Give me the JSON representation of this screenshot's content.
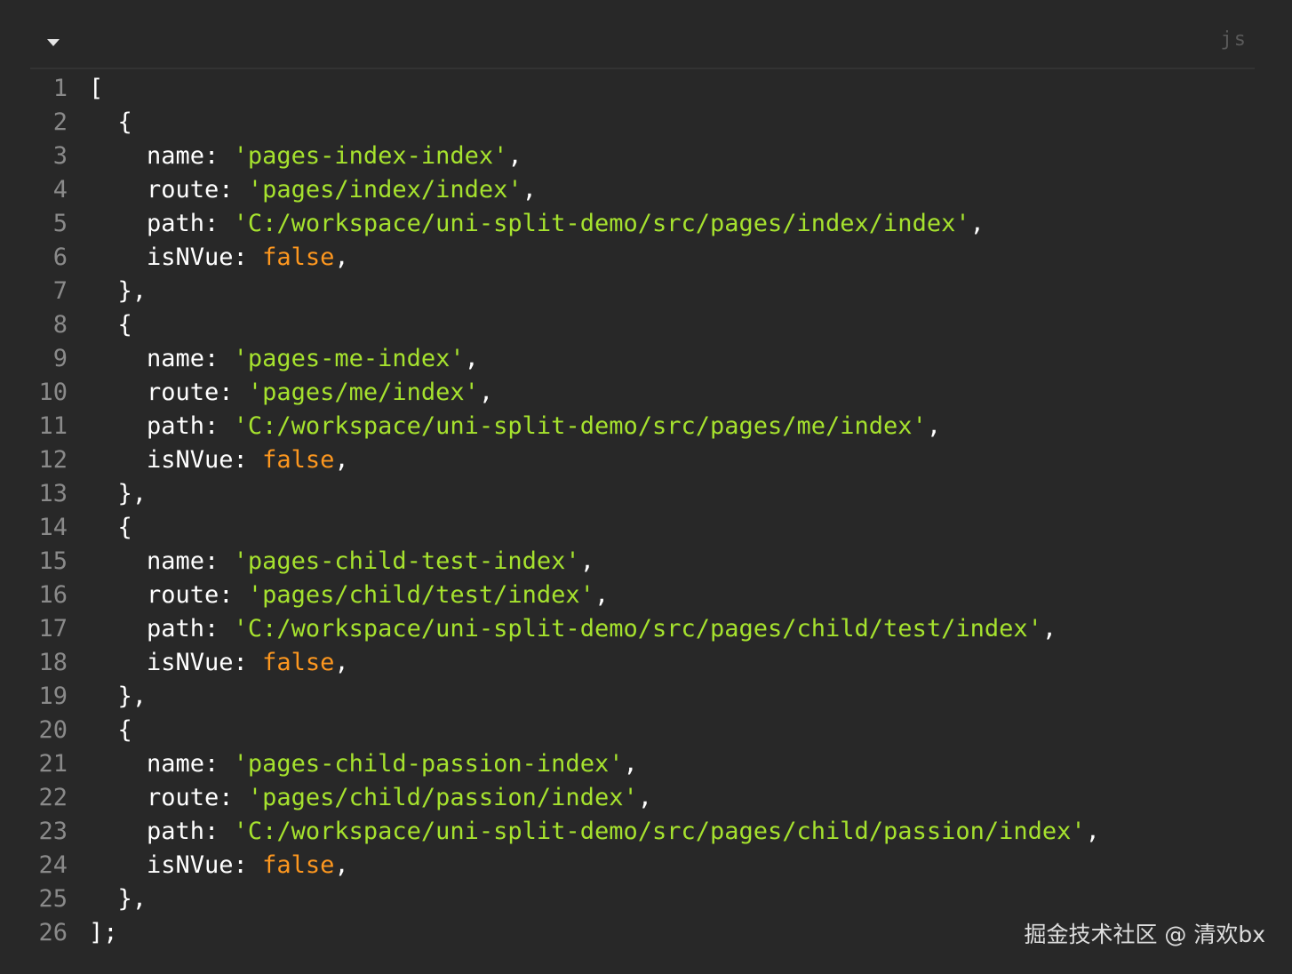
{
  "header": {
    "language": "js",
    "collapse_icon": "caret-down-icon"
  },
  "code": {
    "lines": [
      [
        {
          "t": "p",
          "v": "["
        }
      ],
      [
        {
          "t": "p",
          "v": "  {"
        }
      ],
      [
        {
          "t": "p",
          "v": "    name: "
        },
        {
          "t": "s",
          "v": "'pages-index-index'"
        },
        {
          "t": "p",
          "v": ","
        }
      ],
      [
        {
          "t": "p",
          "v": "    route: "
        },
        {
          "t": "s",
          "v": "'pages/index/index'"
        },
        {
          "t": "p",
          "v": ","
        }
      ],
      [
        {
          "t": "p",
          "v": "    path: "
        },
        {
          "t": "s",
          "v": "'C:/workspace/uni-split-demo/src/pages/index/index'"
        },
        {
          "t": "p",
          "v": ","
        }
      ],
      [
        {
          "t": "p",
          "v": "    isNVue: "
        },
        {
          "t": "b",
          "v": "false"
        },
        {
          "t": "p",
          "v": ","
        }
      ],
      [
        {
          "t": "p",
          "v": "  },"
        }
      ],
      [
        {
          "t": "p",
          "v": "  {"
        }
      ],
      [
        {
          "t": "p",
          "v": "    name: "
        },
        {
          "t": "s",
          "v": "'pages-me-index'"
        },
        {
          "t": "p",
          "v": ","
        }
      ],
      [
        {
          "t": "p",
          "v": "    route: "
        },
        {
          "t": "s",
          "v": "'pages/me/index'"
        },
        {
          "t": "p",
          "v": ","
        }
      ],
      [
        {
          "t": "p",
          "v": "    path: "
        },
        {
          "t": "s",
          "v": "'C:/workspace/uni-split-demo/src/pages/me/index'"
        },
        {
          "t": "p",
          "v": ","
        }
      ],
      [
        {
          "t": "p",
          "v": "    isNVue: "
        },
        {
          "t": "b",
          "v": "false"
        },
        {
          "t": "p",
          "v": ","
        }
      ],
      [
        {
          "t": "p",
          "v": "  },"
        }
      ],
      [
        {
          "t": "p",
          "v": "  {"
        }
      ],
      [
        {
          "t": "p",
          "v": "    name: "
        },
        {
          "t": "s",
          "v": "'pages-child-test-index'"
        },
        {
          "t": "p",
          "v": ","
        }
      ],
      [
        {
          "t": "p",
          "v": "    route: "
        },
        {
          "t": "s",
          "v": "'pages/child/test/index'"
        },
        {
          "t": "p",
          "v": ","
        }
      ],
      [
        {
          "t": "p",
          "v": "    path: "
        },
        {
          "t": "s",
          "v": "'C:/workspace/uni-split-demo/src/pages/child/test/index'"
        },
        {
          "t": "p",
          "v": ","
        }
      ],
      [
        {
          "t": "p",
          "v": "    isNVue: "
        },
        {
          "t": "b",
          "v": "false"
        },
        {
          "t": "p",
          "v": ","
        }
      ],
      [
        {
          "t": "p",
          "v": "  },"
        }
      ],
      [
        {
          "t": "p",
          "v": "  {"
        }
      ],
      [
        {
          "t": "p",
          "v": "    name: "
        },
        {
          "t": "s",
          "v": "'pages-child-passion-index'"
        },
        {
          "t": "p",
          "v": ","
        }
      ],
      [
        {
          "t": "p",
          "v": "    route: "
        },
        {
          "t": "s",
          "v": "'pages/child/passion/index'"
        },
        {
          "t": "p",
          "v": ","
        }
      ],
      [
        {
          "t": "p",
          "v": "    path: "
        },
        {
          "t": "s",
          "v": "'C:/workspace/uni-split-demo/src/pages/child/passion/index'"
        },
        {
          "t": "p",
          "v": ","
        }
      ],
      [
        {
          "t": "p",
          "v": "    isNVue: "
        },
        {
          "t": "b",
          "v": "false"
        },
        {
          "t": "p",
          "v": ","
        }
      ],
      [
        {
          "t": "p",
          "v": "  },"
        }
      ],
      [
        {
          "t": "p",
          "v": "];"
        }
      ]
    ]
  },
  "watermark": "掘金技术社区 @ 清欢bx",
  "colors": {
    "background": "#282828",
    "string": "#a6e22e",
    "boolean": "#fd971f",
    "text": "#ffffff",
    "line_number": "#8a8a8a"
  }
}
